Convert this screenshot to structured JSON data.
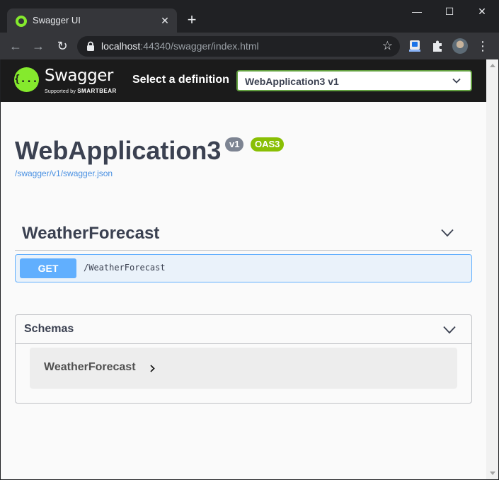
{
  "browser": {
    "tab_title": "Swagger UI",
    "tab_close": "✕",
    "new_tab": "+",
    "window_controls": {
      "minimize": "—",
      "maximize": "☐",
      "close": "✕"
    },
    "nav": {
      "back": "←",
      "forward": "→",
      "reload": "↻"
    },
    "url_host": "localhost",
    "url_rest": ":44340/swagger/index.html",
    "bookmark_icon": "☆",
    "menu_icon": "⋮"
  },
  "swagger": {
    "logo_mark": "{...}",
    "logo_text": "Swagger",
    "logo_sub_prefix": "Supported by",
    "logo_sub_brand": "SMARTBEAR",
    "select_label": "Select a definition",
    "selected_definition": "WebApplication3 v1"
  },
  "info": {
    "title": "WebApplication3",
    "version_badge": "v1",
    "oas_badge": "OAS3",
    "spec_url": "/swagger/v1/swagger.json"
  },
  "tag": {
    "name": "WeatherForecast",
    "operations": [
      {
        "method": "GET",
        "path": "/WeatherForecast"
      }
    ]
  },
  "schemas": {
    "title": "Schemas",
    "items": [
      {
        "name": "WeatherForecast"
      }
    ]
  },
  "colors": {
    "accent_green": "#85ea2d",
    "get_blue": "#61affe",
    "oas_green": "#89bf04",
    "version_grey": "#7d8492",
    "text_dark": "#3b4151"
  }
}
